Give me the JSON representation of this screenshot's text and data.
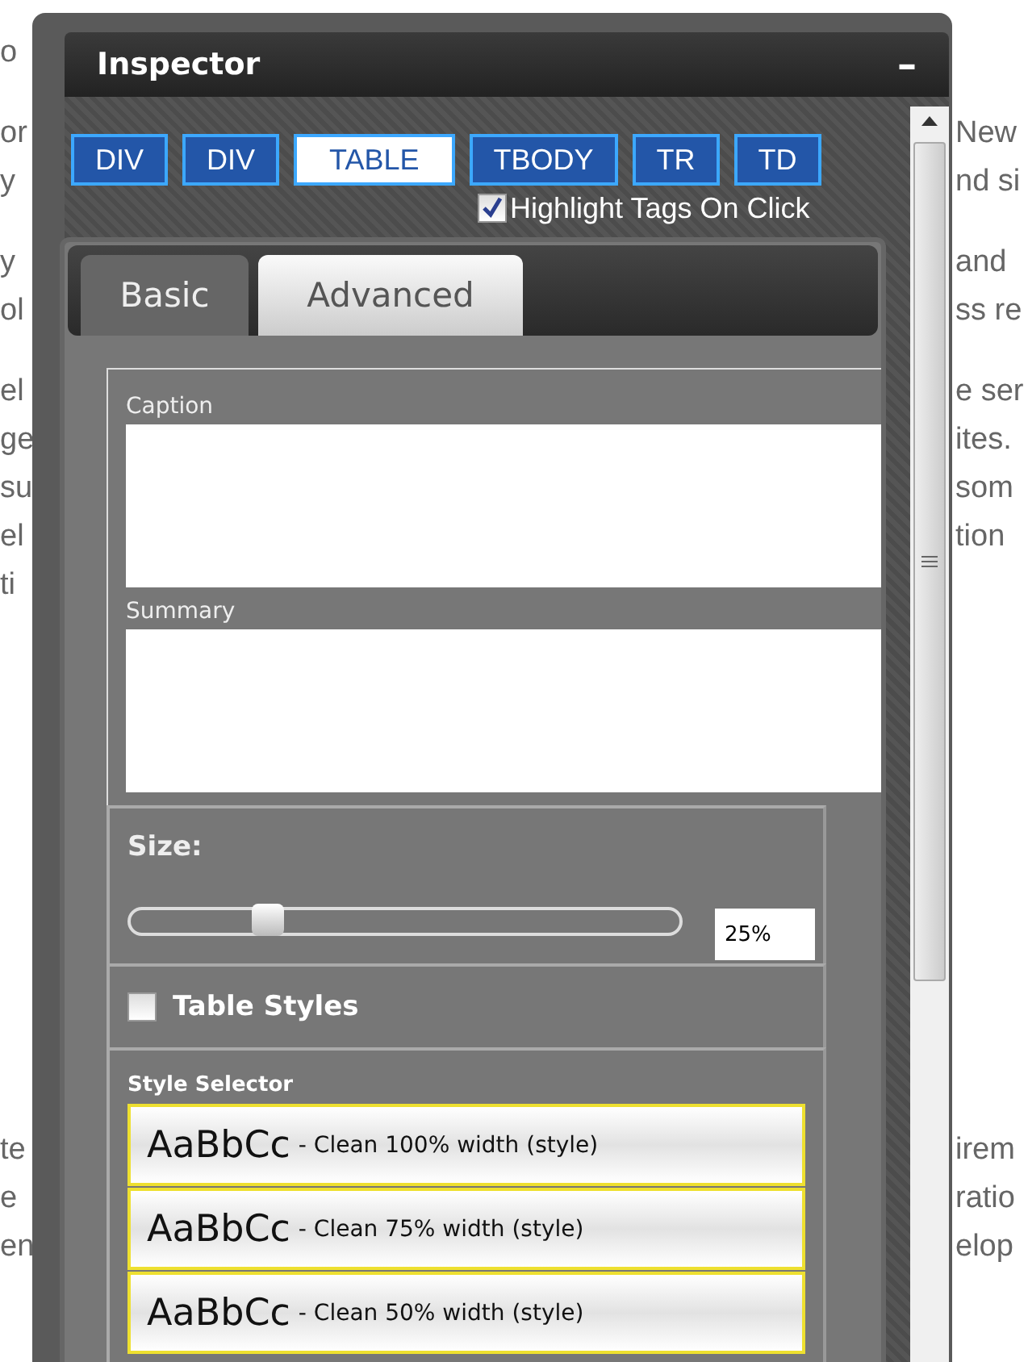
{
  "background_text": [
    {
      "lines": [
        {
          "left": "o"
        }
      ]
    },
    {
      "lines": [
        {
          "left": "or",
          "right": "New"
        },
        {
          "left": "y",
          "right": "nd si"
        }
      ]
    },
    {
      "lines": [
        {
          "left": "y",
          "right": "and"
        },
        {
          "left": "ol",
          "right": "ss re"
        }
      ]
    },
    {
      "lines": [
        {
          "left": "el",
          "right": "e ser"
        },
        {
          "left": "ge",
          "right": "ites."
        },
        {
          "left": "su",
          "right": "som"
        },
        {
          "left": "el",
          "right": "tion"
        },
        {
          "left": "ti"
        }
      ]
    },
    {
      "lines": [
        {
          "left": "te",
          "right": "irem"
        },
        {
          "left": "e",
          "right": "ratio"
        },
        {
          "left": "en",
          "right": "elop"
        }
      ]
    }
  ],
  "inspector": {
    "title": "Inspector",
    "minimize": "–",
    "tags": [
      {
        "label": "DIV",
        "selected": false
      },
      {
        "label": "DIV",
        "selected": false
      },
      {
        "label": "TABLE",
        "selected": true
      },
      {
        "label": "TBODY",
        "selected": false
      },
      {
        "label": "TR",
        "selected": false
      },
      {
        "label": "TD",
        "selected": false
      }
    ],
    "highlight": {
      "label": "Highlight Tags On Click",
      "checked": true
    },
    "tabs": [
      {
        "label": "Basic",
        "selected": true
      },
      {
        "label": "Advanced",
        "selected": false
      }
    ],
    "fields": [
      {
        "label": "Caption"
      },
      {
        "label": "Summary"
      }
    ],
    "size": {
      "label": "Size:",
      "level": 0.25,
      "value": "25%"
    },
    "table_styles": {
      "label": "Table Styles",
      "checked": false
    },
    "style_selector": {
      "label": "Style Selector",
      "items": [
        {
          "sample": "AaBbCc",
          "label": "- Clean 100% width (style)"
        },
        {
          "sample": "AaBbCc",
          "label": "- Clean 75% width (style)"
        },
        {
          "sample": "AaBbCc",
          "label": "- Clean 50% width (style)"
        }
      ]
    }
  }
}
